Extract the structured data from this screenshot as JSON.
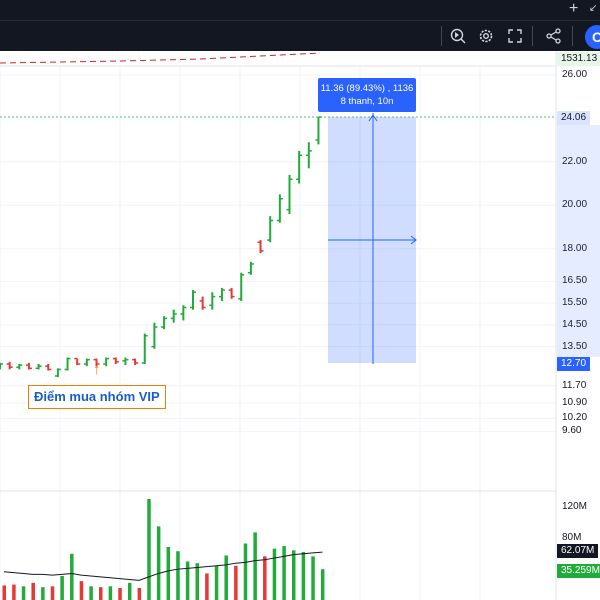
{
  "toolbar": {
    "plus_icon": "+",
    "minimize_icon": "↙",
    "icons": [
      "replay-icon",
      "gear-icon",
      "fullscreen-icon",
      "share-icon"
    ],
    "logo_letter": "C"
  },
  "indicator_tag": "1531.13",
  "price_axis": {
    "ticks": [
      "26.00",
      "24.06",
      "22.00",
      "20.00",
      "18.00",
      "16.50",
      "15.50",
      "14.50",
      "13.50",
      "12.70",
      "11.70",
      "10.90",
      "10.20",
      "9.60"
    ]
  },
  "price_tags": {
    "high": "24.06",
    "low": "12.70"
  },
  "volume_axis": {
    "ticks": [
      "120M",
      "80M"
    ],
    "current": "62.07M",
    "ma": "35.259M"
  },
  "measure": {
    "line1": "11.36 (89.43%) , 1136",
    "line2": "8 thanh, 10n"
  },
  "annotation": {
    "label": "Điểm mua nhóm VIP"
  },
  "colors": {
    "up": "#22ab3a",
    "down": "#e53935",
    "accent": "#2962ff",
    "annotation_border": "#f57c00"
  },
  "chart_data": {
    "type": "bar",
    "series": [
      {
        "name": "",
        "candles": [
          {
            "o": 12.55,
            "h": 12.75,
            "l": 12.45,
            "c": 12.7
          },
          {
            "o": 12.7,
            "h": 12.8,
            "l": 12.45,
            "c": 12.55
          },
          {
            "o": 12.55,
            "h": 12.7,
            "l": 12.45,
            "c": 12.65
          },
          {
            "o": 12.65,
            "h": 12.75,
            "l": 12.45,
            "c": 12.5
          },
          {
            "o": 12.5,
            "h": 12.7,
            "l": 12.45,
            "c": 12.6
          },
          {
            "o": 12.6,
            "h": 12.7,
            "l": 12.4,
            "c": 12.45
          },
          {
            "o": 12.15,
            "h": 12.5,
            "l": 12.1,
            "c": 12.45
          },
          {
            "o": 12.45,
            "h": 13.0,
            "l": 12.4,
            "c": 12.95
          },
          {
            "o": 12.95,
            "h": 12.95,
            "l": 12.65,
            "c": 12.7
          },
          {
            "o": 12.7,
            "h": 12.95,
            "l": 12.6,
            "c": 12.9
          },
          {
            "o": 12.9,
            "h": 12.95,
            "l": 12.6,
            "c": 12.7
          },
          {
            "o": 12.7,
            "h": 13.0,
            "l": 12.6,
            "c": 12.95
          },
          {
            "o": 12.95,
            "h": 13.0,
            "l": 12.7,
            "c": 12.8
          },
          {
            "o": 12.85,
            "h": 13.0,
            "l": 12.65,
            "c": 12.9
          },
          {
            "o": 12.9,
            "h": 12.95,
            "l": 12.65,
            "c": 12.75
          },
          {
            "o": 12.75,
            "h": 14.1,
            "l": 12.7,
            "c": 14.0
          },
          {
            "o": 13.5,
            "h": 14.6,
            "l": 13.4,
            "c": 14.4
          },
          {
            "o": 14.4,
            "h": 14.9,
            "l": 14.3,
            "c": 14.8
          },
          {
            "o": 14.8,
            "h": 15.2,
            "l": 14.6,
            "c": 15.0
          },
          {
            "o": 15.0,
            "h": 15.4,
            "l": 14.7,
            "c": 15.3
          },
          {
            "o": 15.3,
            "h": 16.1,
            "l": 15.2,
            "c": 16.0
          },
          {
            "o": 15.6,
            "h": 15.8,
            "l": 15.2,
            "c": 15.3
          },
          {
            "o": 15.4,
            "h": 16.0,
            "l": 15.2,
            "c": 15.8
          },
          {
            "o": 15.8,
            "h": 16.2,
            "l": 15.6,
            "c": 16.1
          },
          {
            "o": 16.1,
            "h": 16.2,
            "l": 15.7,
            "c": 15.8
          },
          {
            "o": 15.7,
            "h": 16.9,
            "l": 15.6,
            "c": 16.8
          },
          {
            "o": 16.9,
            "h": 17.4,
            "l": 16.8,
            "c": 17.3
          },
          {
            "o": 18.3,
            "h": 18.4,
            "l": 17.8,
            "c": 17.9
          },
          {
            "o": 18.4,
            "h": 19.5,
            "l": 18.3,
            "c": 19.3
          },
          {
            "o": 19.3,
            "h": 20.5,
            "l": 19.2,
            "c": 20.3
          },
          {
            "o": 19.8,
            "h": 21.4,
            "l": 19.6,
            "c": 21.2
          },
          {
            "o": 21.2,
            "h": 22.5,
            "l": 21.0,
            "c": 22.3
          },
          {
            "o": 22.3,
            "h": 22.9,
            "l": 21.7,
            "c": 22.5
          },
          {
            "o": 23.0,
            "h": 24.06,
            "l": 22.8,
            "c": 24.06
          }
        ]
      }
    ],
    "volume": [
      {
        "v": 17,
        "up": false
      },
      {
        "v": 18,
        "up": false
      },
      {
        "v": 16,
        "up": true
      },
      {
        "v": 20,
        "up": false
      },
      {
        "v": 15,
        "up": true
      },
      {
        "v": 16,
        "up": false
      },
      {
        "v": 28,
        "up": true
      },
      {
        "v": 54,
        "up": true
      },
      {
        "v": 22,
        "up": false
      },
      {
        "v": 16,
        "up": true
      },
      {
        "v": 15,
        "up": false
      },
      {
        "v": 16,
        "up": true
      },
      {
        "v": 14,
        "up": false
      },
      {
        "v": 20,
        "up": true
      },
      {
        "v": 14,
        "up": false
      },
      {
        "v": 118,
        "up": true
      },
      {
        "v": 86,
        "up": true
      },
      {
        "v": 62,
        "up": true
      },
      {
        "v": 57,
        "up": true
      },
      {
        "v": 45,
        "up": true
      },
      {
        "v": 43,
        "up": true
      },
      {
        "v": 31,
        "up": false
      },
      {
        "v": 40,
        "up": true
      },
      {
        "v": 52,
        "up": true
      },
      {
        "v": 40,
        "up": false
      },
      {
        "v": 66,
        "up": true
      },
      {
        "v": 79,
        "up": true
      },
      {
        "v": 51,
        "up": false
      },
      {
        "v": 60,
        "up": true
      },
      {
        "v": 63,
        "up": true
      },
      {
        "v": 58,
        "up": true
      },
      {
        "v": 56,
        "up": true
      },
      {
        "v": 51,
        "up": true
      },
      {
        "v": 36,
        "up": true
      }
    ],
    "volume_ma": [
      33,
      32,
      31,
      30,
      30,
      29,
      30,
      31,
      29,
      28,
      27,
      26,
      25,
      24,
      23,
      27,
      31,
      34,
      36,
      37,
      38,
      39,
      40,
      41,
      43,
      44,
      46,
      47,
      49,
      51,
      53,
      54,
      55,
      56
    ],
    "ylim_price": [
      9.2,
      27.0
    ],
    "ylim_volume": [
      0,
      130
    ],
    "grid": true
  }
}
